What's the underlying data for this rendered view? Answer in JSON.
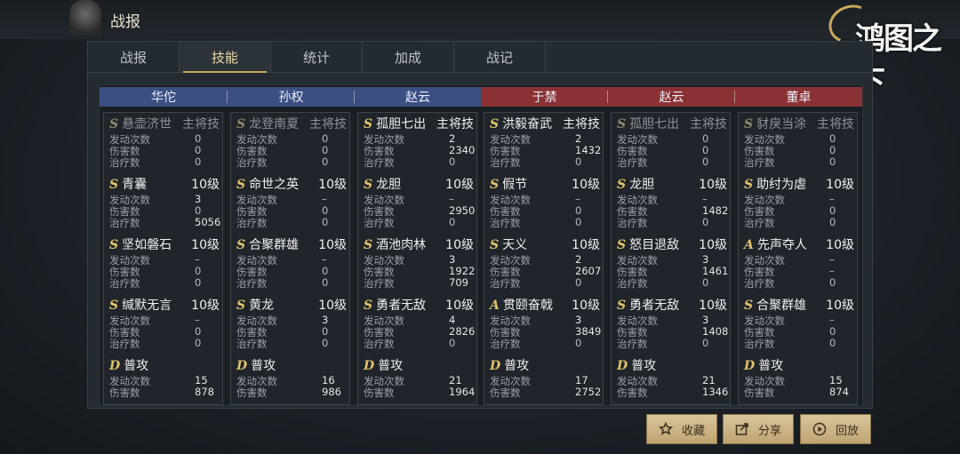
{
  "header": {
    "title": "战报",
    "logo_text": "鸿图之下"
  },
  "tabs": [
    {
      "label": "战报",
      "active": false
    },
    {
      "label": "技能",
      "active": true
    },
    {
      "label": "统计",
      "active": false
    },
    {
      "label": "加成",
      "active": false
    },
    {
      "label": "战记",
      "active": false
    }
  ],
  "teams": {
    "blue_color": "#3a4f82",
    "red_color": "#8a3233"
  },
  "stat_labels": {
    "trigger": "发动次数",
    "damage": "伤害数",
    "heal": "治疗数"
  },
  "columns": [
    {
      "name": "华佗",
      "side": "blue",
      "skills": [
        {
          "grade": "S",
          "name": "悬壶济世",
          "level": "主将技",
          "dim": true,
          "trigger": "0",
          "damage": "0",
          "heal": "0"
        },
        {
          "grade": "S",
          "name": "青囊",
          "level": "10级",
          "dim": false,
          "trigger": "3",
          "damage": "0",
          "heal": "5056"
        },
        {
          "grade": "S",
          "name": "坚如磐石",
          "level": "10级",
          "dim": false,
          "trigger": "–",
          "damage": "0",
          "heal": "0"
        },
        {
          "grade": "S",
          "name": "缄默无言",
          "level": "10级",
          "dim": false,
          "trigger": "–",
          "damage": "0",
          "heal": "0"
        },
        {
          "grade": "D",
          "name": "普攻",
          "level": "",
          "dim": false,
          "trigger": "15",
          "damage": "878",
          "heal": null
        }
      ]
    },
    {
      "name": "孙权",
      "side": "blue",
      "skills": [
        {
          "grade": "S",
          "name": "龙登南夏",
          "level": "主将技",
          "dim": true,
          "trigger": "0",
          "damage": "0",
          "heal": "0"
        },
        {
          "grade": "S",
          "name": "命世之英",
          "level": "10级",
          "dim": false,
          "trigger": "–",
          "damage": "0",
          "heal": "0"
        },
        {
          "grade": "S",
          "name": "合聚群雄",
          "level": "10级",
          "dim": false,
          "trigger": "–",
          "damage": "0",
          "heal": "0"
        },
        {
          "grade": "S",
          "name": "黄龙",
          "level": "10级",
          "dim": false,
          "trigger": "3",
          "damage": "0",
          "heal": "0"
        },
        {
          "grade": "D",
          "name": "普攻",
          "level": "",
          "dim": false,
          "trigger": "16",
          "damage": "986",
          "heal": null
        }
      ]
    },
    {
      "name": "赵云",
      "side": "blue",
      "skills": [
        {
          "grade": "S",
          "name": "孤胆七出",
          "level": "主将技",
          "dim": false,
          "trigger": "2",
          "damage": "2340",
          "heal": "0"
        },
        {
          "grade": "S",
          "name": "龙胆",
          "level": "10级",
          "dim": false,
          "trigger": "–",
          "damage": "2950",
          "heal": "0"
        },
        {
          "grade": "S",
          "name": "酒池肉林",
          "level": "10级",
          "dim": false,
          "trigger": "3",
          "damage": "1922",
          "heal": "709"
        },
        {
          "grade": "S",
          "name": "勇者无敌",
          "level": "10级",
          "dim": false,
          "trigger": "4",
          "damage": "2826",
          "heal": "0"
        },
        {
          "grade": "D",
          "name": "普攻",
          "level": "",
          "dim": false,
          "trigger": "21",
          "damage": "1964",
          "heal": null
        }
      ]
    },
    {
      "name": "于禁",
      "side": "red",
      "skills": [
        {
          "grade": "S",
          "name": "洪毅奋武",
          "level": "主将技",
          "dim": false,
          "trigger": "2",
          "damage": "1432",
          "heal": "0"
        },
        {
          "grade": "S",
          "name": "假节",
          "level": "10级",
          "dim": false,
          "trigger": "–",
          "damage": "0",
          "heal": "0"
        },
        {
          "grade": "S",
          "name": "天义",
          "level": "10级",
          "dim": false,
          "trigger": "2",
          "damage": "2607",
          "heal": "0"
        },
        {
          "grade": "A",
          "name": "贯颐奋戟",
          "level": "10级",
          "dim": false,
          "trigger": "3",
          "damage": "3849",
          "heal": "0"
        },
        {
          "grade": "D",
          "name": "普攻",
          "level": "",
          "dim": false,
          "trigger": "17",
          "damage": "2752",
          "heal": null
        }
      ]
    },
    {
      "name": "赵云",
      "side": "red",
      "skills": [
        {
          "grade": "S",
          "name": "孤胆七出",
          "level": "主将技",
          "dim": true,
          "trigger": "0",
          "damage": "0",
          "heal": "0"
        },
        {
          "grade": "S",
          "name": "龙胆",
          "level": "10级",
          "dim": false,
          "trigger": "–",
          "damage": "1482",
          "heal": "0"
        },
        {
          "grade": "S",
          "name": "怒目退敌",
          "level": "10级",
          "dim": false,
          "trigger": "3",
          "damage": "1461",
          "heal": "0"
        },
        {
          "grade": "S",
          "name": "勇者无敌",
          "level": "10级",
          "dim": false,
          "trigger": "3",
          "damage": "1408",
          "heal": "0"
        },
        {
          "grade": "D",
          "name": "普攻",
          "level": "",
          "dim": false,
          "trigger": "21",
          "damage": "1346",
          "heal": null
        }
      ]
    },
    {
      "name": "董卓",
      "side": "red",
      "skills": [
        {
          "grade": "S",
          "name": "豺戾当涂",
          "level": "主将技",
          "dim": true,
          "trigger": "0",
          "damage": "0",
          "heal": "0"
        },
        {
          "grade": "S",
          "name": "助纣为虐",
          "level": "10级",
          "dim": false,
          "trigger": "–",
          "damage": "0",
          "heal": "0"
        },
        {
          "grade": "A",
          "name": "先声夺人",
          "level": "10级",
          "dim": false,
          "trigger": "–",
          "damage": "–",
          "heal": "0"
        },
        {
          "grade": "S",
          "name": "合聚群雄",
          "level": "10级",
          "dim": false,
          "trigger": "–",
          "damage": "0",
          "heal": "0"
        },
        {
          "grade": "D",
          "name": "普攻",
          "level": "",
          "dim": false,
          "trigger": "15",
          "damage": "874",
          "heal": null
        }
      ]
    }
  ],
  "buttons": [
    {
      "label": "收藏",
      "icon": "star-icon"
    },
    {
      "label": "分享",
      "icon": "share-icon"
    },
    {
      "label": "回放",
      "icon": "play-icon"
    }
  ]
}
